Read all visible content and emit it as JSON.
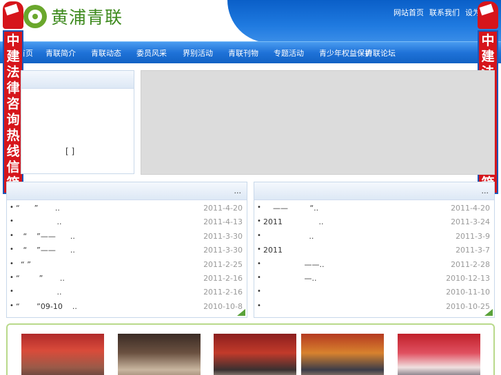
{
  "header": {
    "logo_text": "黄浦青联",
    "top_links": [
      "网站首页",
      "联系我们",
      "设为首页"
    ],
    "nav": [
      "首页",
      "青联简介",
      "青联动态",
      "委员风采",
      "界别活动",
      "青联刊物",
      "专题活动",
      "青少年权益保护",
      "青联论坛"
    ]
  },
  "side_banner": {
    "text": "中建法律咨询热线信箱"
  },
  "notice": {
    "bracket": "[ ]"
  },
  "left_list": {
    "more": "...",
    "items": [
      {
        "title": "“      ”       ..",
        "date": "2011-4-20"
      },
      {
        "title": "                 ..",
        "date": "2011-4-13"
      },
      {
        "title": "   “    ”——      ..",
        "date": "2011-3-30"
      },
      {
        "title": "   “    ”——      ..",
        "date": "2011-3-30"
      },
      {
        "title": "  “ ”",
        "date": "2011-2-25"
      },
      {
        "title": "“        ”       ..",
        "date": "2011-2-16"
      },
      {
        "title": "                 ..",
        "date": "2011-2-16"
      },
      {
        "title": "“       ”09-10    ..",
        "date": "2010-10-8"
      }
    ]
  },
  "right_list": {
    "more": "...",
    "items": [
      {
        "title": "    ——         “..",
        "date": "2011-4-20"
      },
      {
        "title": "2011               ..",
        "date": "2011-3-24"
      },
      {
        "title": "                   ..",
        "date": "2011-3-9"
      },
      {
        "title": "2011",
        "date": "2011-3-7"
      },
      {
        "title": "                 ——..",
        "date": "2011-2-28"
      },
      {
        "title": "                 —..",
        "date": "2010-12-13"
      },
      {
        "title": "",
        "date": "2010-11-10"
      },
      {
        "title": "",
        "date": "2010-10-25"
      }
    ]
  },
  "colors": {
    "accent_blue": "#1f72d8",
    "banner_red": "#d6151b",
    "logo_green": "#3e8a1e"
  }
}
